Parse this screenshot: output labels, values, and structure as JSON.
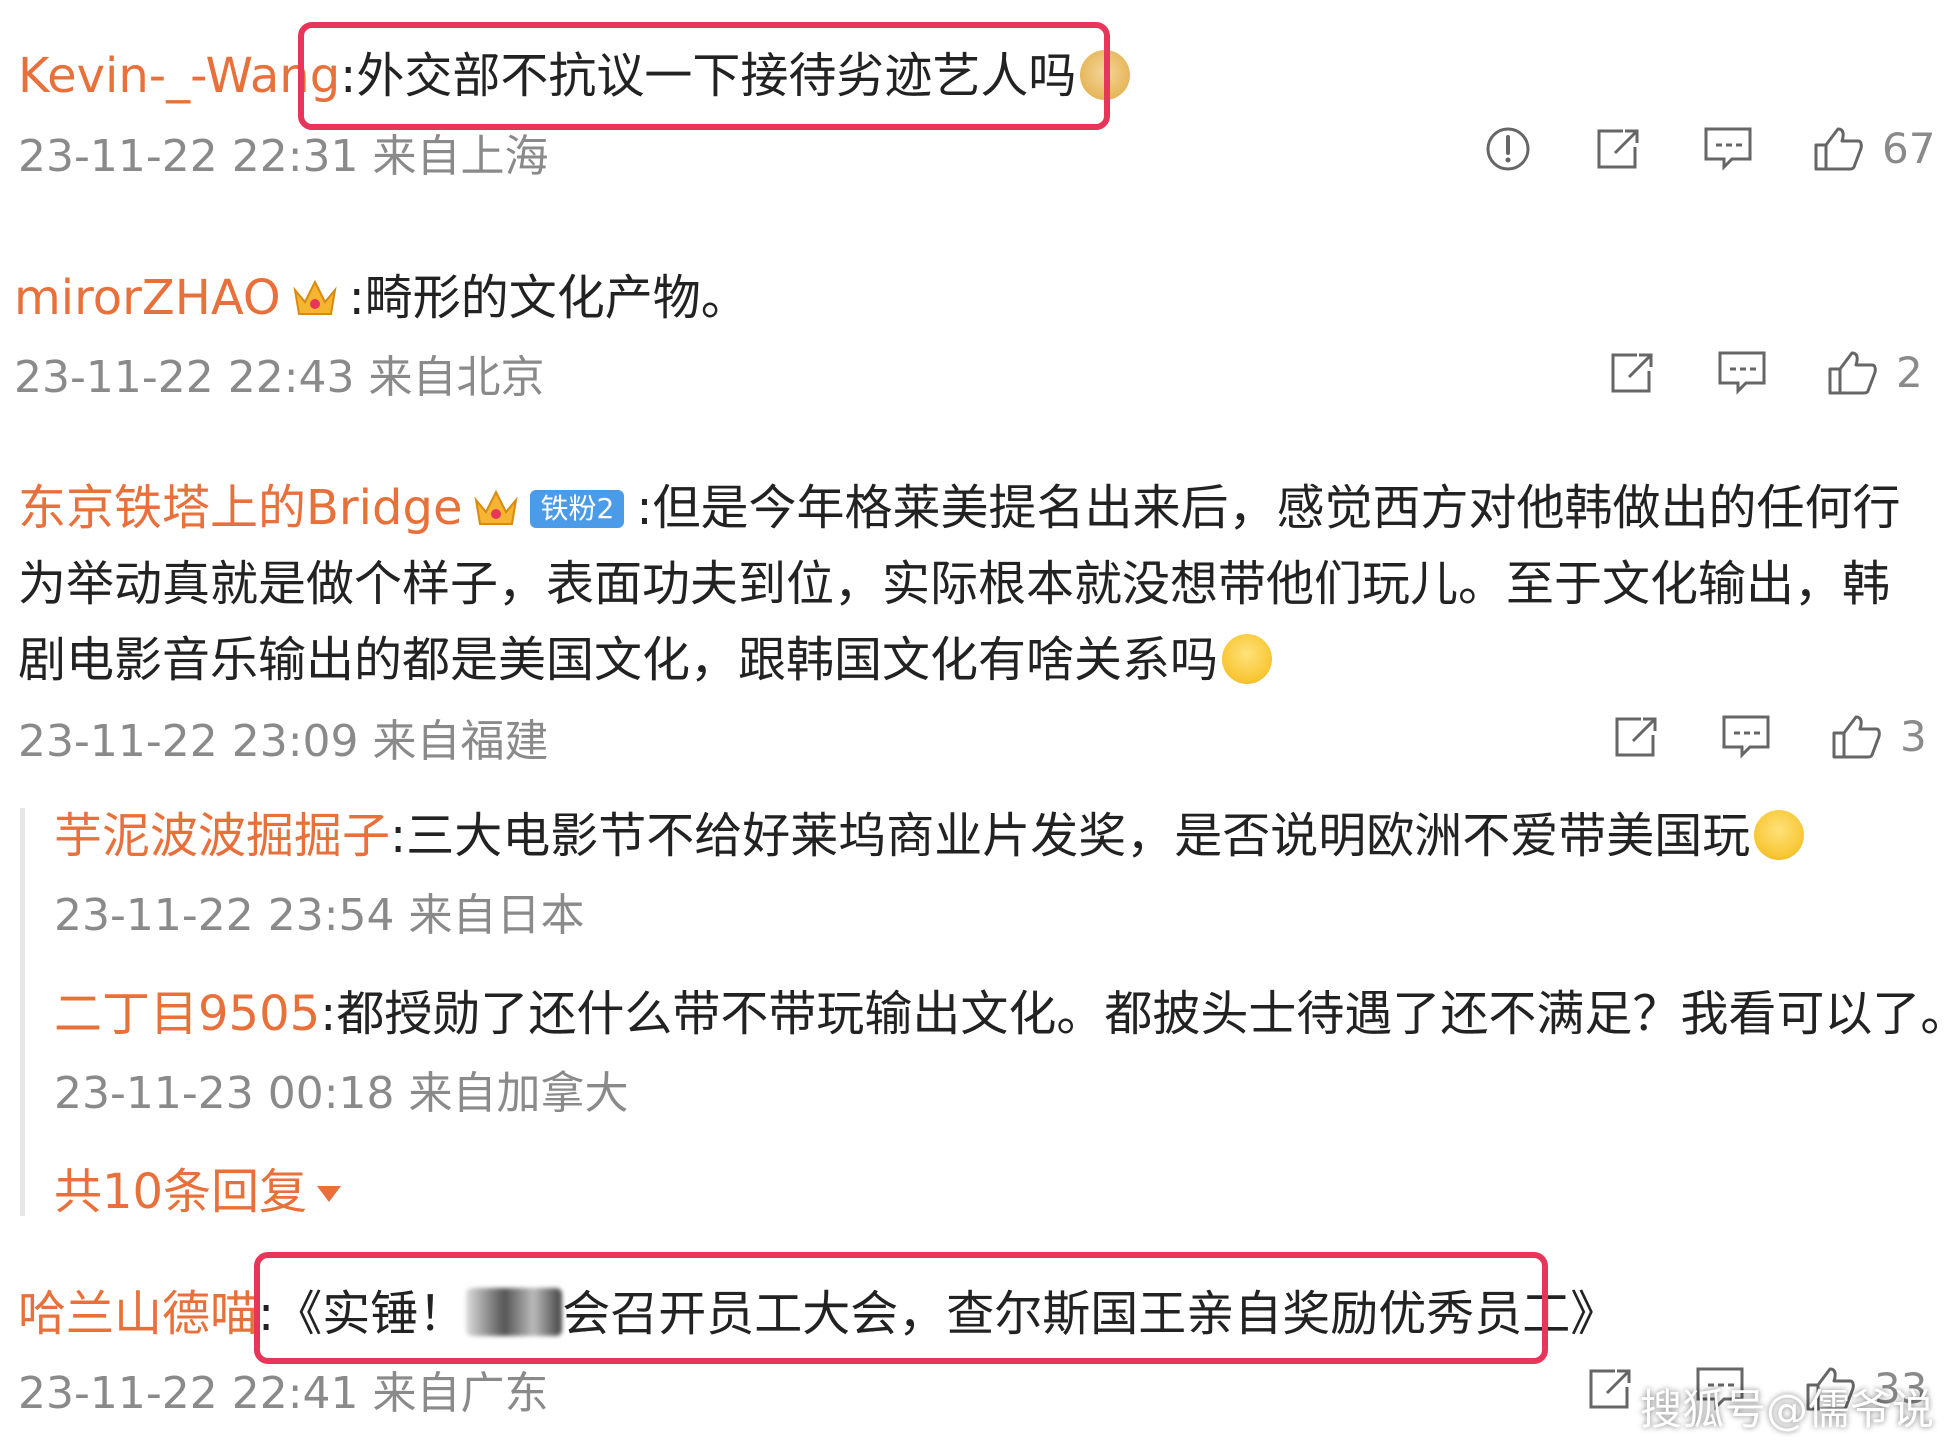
{
  "comments": [
    {
      "user": "Kevin-_-Wang",
      "text": ":外交部不抗议一下接待劣迹艺人吗",
      "emoji": "doge-emoji",
      "meta": "23-11-22 22:31 来自上海",
      "likes": "67"
    },
    {
      "user": "mirorZHAO",
      "text": ":畸形的文化产物。",
      "meta": "23-11-22 22:43 来自北京",
      "likes": "2"
    },
    {
      "user": "东京铁塔上的Bridge",
      "fan_badge": "铁粉2",
      "text": ":但是今年格莱美提名出来后，感觉西方对他韩做出的任何行为举动真就是做个样子，表面功夫到位，实际根本就没想带他们玩儿。至于文化输出，韩剧电影音乐输出的都是美国文化，跟韩国文化有啥关系吗",
      "meta": "23-11-22 23:09 来自福建",
      "likes": "3",
      "replies": [
        {
          "user": "芋泥波波掘掘子",
          "text": ":三大电影节不给好莱坞商业片发奖，是否说明欧洲不爱带美国玩",
          "meta": "23-11-22 23:54 来自日本"
        },
        {
          "user": "二丁目9505",
          "text": ":都授勋了还什么带不带玩输出文化。都披头士待遇了还不满足？我看可以了。",
          "meta": "23-11-23 00:18 来自加拿大"
        }
      ],
      "more_replies": "共10条回复"
    },
    {
      "user": "哈兰山德喵",
      "text_prefix": ":《实锤！",
      "text_suffix": "会召开员工大会，查尔斯国王亲自奖励优秀员工》",
      "meta": "23-11-22 22:41 来自广东",
      "likes": "33"
    }
  ],
  "watermark": "搜狐号@儒爷说",
  "colors": {
    "username": "#E8703A",
    "text": "#222222",
    "meta": "#8a8a8a",
    "highlight": "#E8365A",
    "fan_badge": "#4C9BE8"
  }
}
